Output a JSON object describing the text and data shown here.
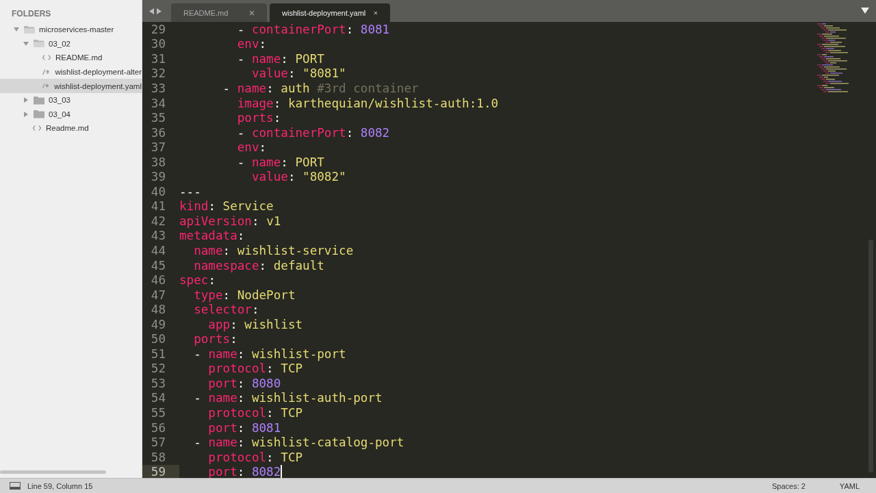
{
  "sidebar": {
    "title": "FOLDERS",
    "items": [
      {
        "kind": "folder",
        "label": "microservices-master",
        "expanded": true,
        "selected": false,
        "children": [
          {
            "kind": "folder",
            "label": "03_02",
            "expanded": true,
            "selected": false,
            "children": [
              {
                "kind": "markup",
                "label": "README.md",
                "selected": false
              },
              {
                "kind": "script",
                "label": "wishlist-deployment-alter",
                "selected": false
              },
              {
                "kind": "script",
                "label": "wishlist-deployment.yaml",
                "selected": true
              }
            ]
          },
          {
            "kind": "folder",
            "label": "03_03",
            "expanded": false,
            "selected": false
          },
          {
            "kind": "folder",
            "label": "03_04",
            "expanded": false,
            "selected": false
          },
          {
            "kind": "markup",
            "label": "Readme.md",
            "selected": false
          }
        ]
      }
    ]
  },
  "tabs": [
    {
      "label": "README.md",
      "selected": false
    },
    {
      "label": "wishlist-deployment.yaml",
      "selected": true
    }
  ],
  "editor": {
    "lines": [
      {
        "number": "29",
        "current": false,
        "tokens": [
          {
            "kind": "punct",
            "text": "        - "
          },
          {
            "kind": "key",
            "text": "containerPort"
          },
          {
            "kind": "punct",
            "text": ": "
          },
          {
            "kind": "number",
            "text": "8081"
          }
        ]
      },
      {
        "number": "30",
        "current": false,
        "tokens": [
          {
            "kind": "key",
            "text": "        env"
          },
          {
            "kind": "punct",
            "text": ":"
          }
        ]
      },
      {
        "number": "31",
        "current": false,
        "tokens": [
          {
            "kind": "punct",
            "text": "        - "
          },
          {
            "kind": "key",
            "text": "name"
          },
          {
            "kind": "punct",
            "text": ": "
          },
          {
            "kind": "value",
            "text": "PORT"
          }
        ]
      },
      {
        "number": "32",
        "current": false,
        "tokens": [
          {
            "kind": "key",
            "text": "          value"
          },
          {
            "kind": "punct",
            "text": ": "
          },
          {
            "kind": "value",
            "text": "\"8081\""
          }
        ]
      },
      {
        "number": "33",
        "current": false,
        "tokens": [
          {
            "kind": "punct",
            "text": "      - "
          },
          {
            "kind": "key",
            "text": "name"
          },
          {
            "kind": "punct",
            "text": ": "
          },
          {
            "kind": "value",
            "text": "auth"
          },
          {
            "kind": "comment",
            "text": " #3rd container"
          }
        ]
      },
      {
        "number": "34",
        "current": false,
        "tokens": [
          {
            "kind": "key",
            "text": "        image"
          },
          {
            "kind": "punct",
            "text": ": "
          },
          {
            "kind": "value",
            "text": "karthequian/wishlist-auth:1.0"
          }
        ]
      },
      {
        "number": "35",
        "current": false,
        "tokens": [
          {
            "kind": "key",
            "text": "        ports"
          },
          {
            "kind": "punct",
            "text": ":"
          }
        ]
      },
      {
        "number": "36",
        "current": false,
        "tokens": [
          {
            "kind": "punct",
            "text": "        - "
          },
          {
            "kind": "key",
            "text": "containerPort"
          },
          {
            "kind": "punct",
            "text": ": "
          },
          {
            "kind": "number",
            "text": "8082"
          }
        ]
      },
      {
        "number": "37",
        "current": false,
        "tokens": [
          {
            "kind": "key",
            "text": "        env"
          },
          {
            "kind": "punct",
            "text": ":"
          }
        ]
      },
      {
        "number": "38",
        "current": false,
        "tokens": [
          {
            "kind": "punct",
            "text": "        - "
          },
          {
            "kind": "key",
            "text": "name"
          },
          {
            "kind": "punct",
            "text": ": "
          },
          {
            "kind": "value",
            "text": "PORT"
          }
        ]
      },
      {
        "number": "39",
        "current": false,
        "tokens": [
          {
            "kind": "key",
            "text": "          value"
          },
          {
            "kind": "punct",
            "text": ": "
          },
          {
            "kind": "value",
            "text": "\"8082\""
          }
        ]
      },
      {
        "number": "40",
        "current": false,
        "tokens": [
          {
            "kind": "punct",
            "text": "---"
          }
        ]
      },
      {
        "number": "41",
        "current": false,
        "tokens": [
          {
            "kind": "key",
            "text": "kind"
          },
          {
            "kind": "punct",
            "text": ": "
          },
          {
            "kind": "value",
            "text": "Service"
          }
        ]
      },
      {
        "number": "42",
        "current": false,
        "tokens": [
          {
            "kind": "key",
            "text": "apiVersion"
          },
          {
            "kind": "punct",
            "text": ": "
          },
          {
            "kind": "value",
            "text": "v1"
          }
        ]
      },
      {
        "number": "43",
        "current": false,
        "tokens": [
          {
            "kind": "key",
            "text": "metadata"
          },
          {
            "kind": "punct",
            "text": ":"
          }
        ]
      },
      {
        "number": "44",
        "current": false,
        "tokens": [
          {
            "kind": "key",
            "text": "  name"
          },
          {
            "kind": "punct",
            "text": ": "
          },
          {
            "kind": "value",
            "text": "wishlist-service"
          }
        ]
      },
      {
        "number": "45",
        "current": false,
        "tokens": [
          {
            "kind": "key",
            "text": "  namespace"
          },
          {
            "kind": "punct",
            "text": ": "
          },
          {
            "kind": "value",
            "text": "default"
          }
        ]
      },
      {
        "number": "46",
        "current": false,
        "tokens": [
          {
            "kind": "key",
            "text": "spec"
          },
          {
            "kind": "punct",
            "text": ":"
          }
        ]
      },
      {
        "number": "47",
        "current": false,
        "tokens": [
          {
            "kind": "key",
            "text": "  type"
          },
          {
            "kind": "punct",
            "text": ": "
          },
          {
            "kind": "value",
            "text": "NodePort"
          }
        ]
      },
      {
        "number": "48",
        "current": false,
        "tokens": [
          {
            "kind": "key",
            "text": "  selector"
          },
          {
            "kind": "punct",
            "text": ":"
          }
        ]
      },
      {
        "number": "49",
        "current": false,
        "tokens": [
          {
            "kind": "key",
            "text": "    app"
          },
          {
            "kind": "punct",
            "text": ": "
          },
          {
            "kind": "value",
            "text": "wishlist"
          }
        ]
      },
      {
        "number": "50",
        "current": false,
        "tokens": [
          {
            "kind": "key",
            "text": "  ports"
          },
          {
            "kind": "punct",
            "text": ":"
          }
        ]
      },
      {
        "number": "51",
        "current": false,
        "tokens": [
          {
            "kind": "punct",
            "text": "  - "
          },
          {
            "kind": "key",
            "text": "name"
          },
          {
            "kind": "punct",
            "text": ": "
          },
          {
            "kind": "value",
            "text": "wishlist-port"
          }
        ]
      },
      {
        "number": "52",
        "current": false,
        "tokens": [
          {
            "kind": "key",
            "text": "    protocol"
          },
          {
            "kind": "punct",
            "text": ": "
          },
          {
            "kind": "value",
            "text": "TCP"
          }
        ]
      },
      {
        "number": "53",
        "current": false,
        "tokens": [
          {
            "kind": "key",
            "text": "    port"
          },
          {
            "kind": "punct",
            "text": ": "
          },
          {
            "kind": "number",
            "text": "8080"
          }
        ]
      },
      {
        "number": "54",
        "current": false,
        "tokens": [
          {
            "kind": "punct",
            "text": "  - "
          },
          {
            "kind": "key",
            "text": "name"
          },
          {
            "kind": "punct",
            "text": ": "
          },
          {
            "kind": "value",
            "text": "wishlist-auth-port"
          }
        ]
      },
      {
        "number": "55",
        "current": false,
        "tokens": [
          {
            "kind": "key",
            "text": "    protocol"
          },
          {
            "kind": "punct",
            "text": ": "
          },
          {
            "kind": "value",
            "text": "TCP"
          }
        ]
      },
      {
        "number": "56",
        "current": false,
        "tokens": [
          {
            "kind": "key",
            "text": "    port"
          },
          {
            "kind": "punct",
            "text": ": "
          },
          {
            "kind": "number",
            "text": "8081"
          }
        ]
      },
      {
        "number": "57",
        "current": false,
        "tokens": [
          {
            "kind": "punct",
            "text": "  - "
          },
          {
            "kind": "key",
            "text": "name"
          },
          {
            "kind": "punct",
            "text": ": "
          },
          {
            "kind": "value",
            "text": "wishlist-catalog-port"
          }
        ]
      },
      {
        "number": "58",
        "current": false,
        "tokens": [
          {
            "kind": "key",
            "text": "    protocol"
          },
          {
            "kind": "punct",
            "text": ": "
          },
          {
            "kind": "value",
            "text": "TCP"
          }
        ]
      },
      {
        "number": "59",
        "current": true,
        "tokens": [
          {
            "kind": "key",
            "text": "    port"
          },
          {
            "kind": "punct",
            "text": ": "
          },
          {
            "kind": "number",
            "text": "8082"
          }
        ]
      }
    ]
  },
  "status_bar": {
    "position": "Line 59, Column 15",
    "indentation": "Spaces: 2",
    "syntax": "YAML"
  }
}
